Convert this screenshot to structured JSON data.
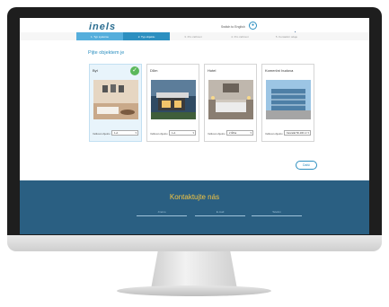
{
  "brand": {
    "logo": "inels"
  },
  "header": {
    "lang_switch": "Switch to English",
    "flags": [
      "cz-flag",
      "sk-flag"
    ]
  },
  "steps": [
    {
      "label": "1. Typ systému",
      "state": "done"
    },
    {
      "label": "2. Typ objektu",
      "state": "active"
    },
    {
      "label": "3. Pro zařízení",
      "state": "todo"
    },
    {
      "label": "4. Pro zařízení",
      "state": "todo"
    },
    {
      "label": "5. Kontaktní údaje",
      "state": "todo"
    }
  ],
  "main": {
    "heading": "Pijte objektem je",
    "cards": [
      {
        "title": "Byt",
        "select_label": "Velikost objektu",
        "select_value": "1+1",
        "selected": true
      },
      {
        "title": "Dům",
        "select_label": "Velikost objektu",
        "select_value": "1+1",
        "selected": false
      },
      {
        "title": "Hotel",
        "select_label": "Velikost objektu",
        "select_value": "2 lůžka",
        "selected": false
      },
      {
        "title": "Komerční budova",
        "select_label": "Velikost objektu",
        "select_value": "Kancelář 50-100 m²",
        "selected": false
      }
    ],
    "next_label": "Další"
  },
  "footer": {
    "title": "Kontaktujte nás",
    "fields": [
      "Jméno",
      "E-mail",
      "Telefon"
    ]
  },
  "colors": {
    "accent": "#2c8fc0",
    "footer_bg": "#2a5f82",
    "footer_title": "#f4c542",
    "check": "#5bb85b"
  }
}
